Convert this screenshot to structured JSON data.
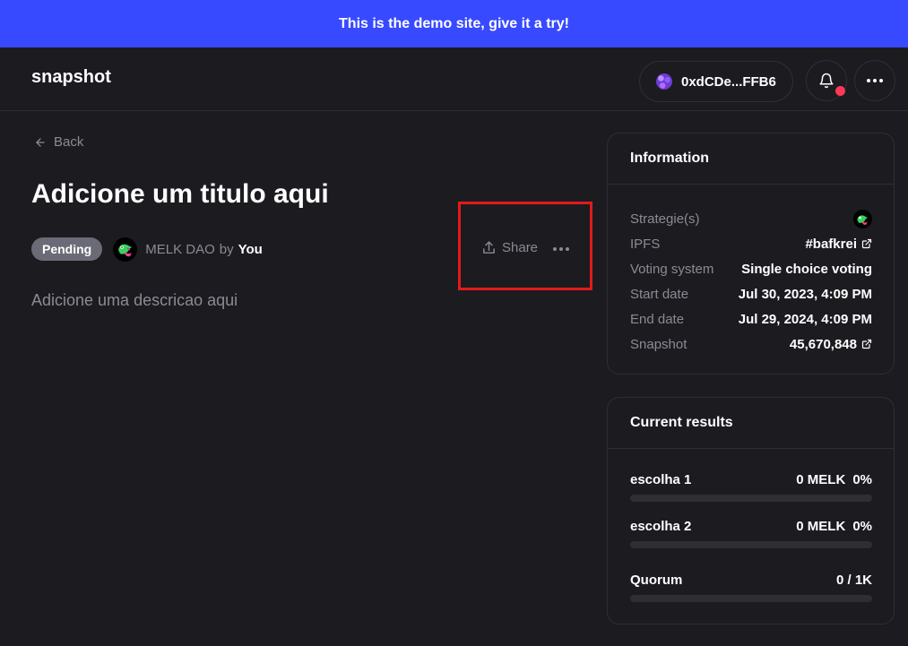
{
  "banner": {
    "text": "This is the demo site, give it a try!"
  },
  "header": {
    "logo": "snapshot",
    "account": "0xdCDe...FFB6",
    "notification_dot_color": "#ff3856"
  },
  "proposal": {
    "back_label": "Back",
    "title": "Adicione um titulo aqui",
    "status": "Pending",
    "space": "MELK DAO",
    "by": "by",
    "author": "You",
    "share_label": "Share",
    "description": "Adicione uma descricao aqui"
  },
  "information": {
    "heading": "Information",
    "rows": [
      {
        "label": "Strategie(s)",
        "value": "",
        "icon": "melk-avatar-icon"
      },
      {
        "label": "IPFS",
        "value": "#bafkrei",
        "icon": "external-link-icon"
      },
      {
        "label": "Voting system",
        "value": "Single choice voting"
      },
      {
        "label": "Start date",
        "value": "Jul 30, 2023, 4:09 PM"
      },
      {
        "label": "End date",
        "value": "Jul 29, 2024, 4:09 PM"
      },
      {
        "label": "Snapshot",
        "value": "45,670,848",
        "icon": "external-link-icon"
      }
    ]
  },
  "results": {
    "heading": "Current results",
    "choices": [
      {
        "name": "escolha 1",
        "amount": "0 MELK",
        "percent": "0%",
        "fraction": 0
      },
      {
        "name": "escolha 2",
        "amount": "0 MELK",
        "percent": "0%",
        "fraction": 0
      }
    ],
    "quorum": {
      "label": "Quorum",
      "value": "0 / 1K",
      "fraction": 0
    }
  },
  "colors": {
    "accent": "#384aff",
    "background": "#1c1b20",
    "muted_text": "#8b8b95",
    "highlight_box": "#e41a1a"
  }
}
